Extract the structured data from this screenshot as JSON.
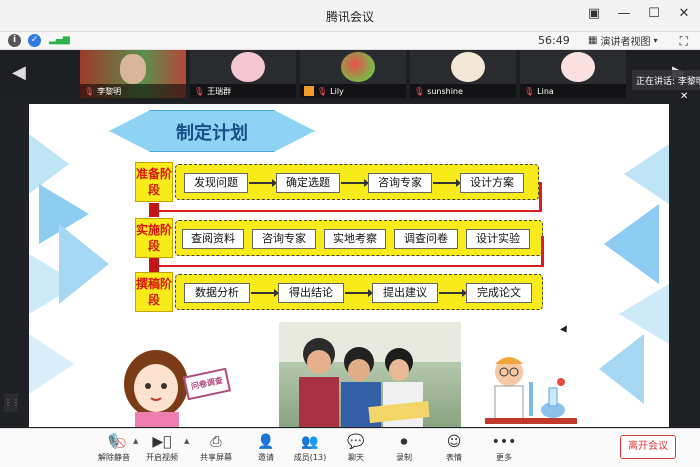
{
  "window": {
    "title": "腾讯会议"
  },
  "info_bar": {
    "timer": "56:49",
    "view_label": "演讲者视图"
  },
  "participants": [
    {
      "name": "李黎明"
    },
    {
      "name": "王瑞群"
    },
    {
      "name": "Lily"
    },
    {
      "name": "sunshine"
    },
    {
      "name": "Lina"
    }
  ],
  "speaking_label": "正在讲话: 李黎明",
  "slide": {
    "banner_title": "制定计划",
    "stages": [
      {
        "label": "准备阶段",
        "steps": [
          "发现问题",
          "确定选题",
          "咨询专家",
          "设计方案"
        ]
      },
      {
        "label": "实施阶段",
        "steps": [
          "查阅资料",
          "咨询专家",
          "实地考察",
          "调查问卷",
          "设计实验"
        ]
      },
      {
        "label": "撰稿阶段",
        "steps": [
          "数据分析",
          "得出结论",
          "提出建议",
          "完成论文"
        ]
      }
    ],
    "sticker_text": "问卷调查"
  },
  "toolbar": {
    "items": [
      {
        "label": "解除静音",
        "icon": "mic-muted-icon"
      },
      {
        "label": "开启视频",
        "icon": "video-off-icon"
      },
      {
        "label": "共享屏幕",
        "icon": "share-screen-icon"
      },
      {
        "label": "邀请",
        "icon": "invite-icon"
      },
      {
        "label": "成员(13)",
        "icon": "members-icon"
      },
      {
        "label": "聊天",
        "icon": "chat-icon"
      },
      {
        "label": "录制",
        "icon": "record-icon"
      },
      {
        "label": "表情",
        "icon": "emoji-icon"
      },
      {
        "label": "更多",
        "icon": "more-icon"
      }
    ],
    "leave_label": "离开会议",
    "leave_color": "#e03c3c"
  }
}
